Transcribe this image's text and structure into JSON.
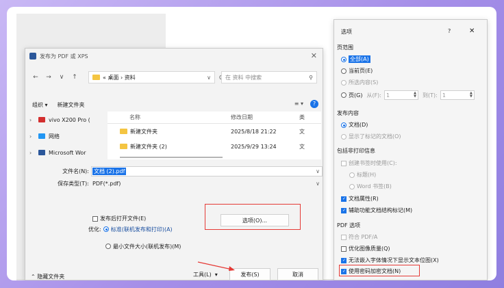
{
  "save_dialog": {
    "title": "发布为 PDF 或 XPS",
    "close": "✕",
    "nav": {
      "back": "←",
      "forward": "→",
      "dropdown": "∨",
      "up": "↑"
    },
    "address": {
      "sep": "«",
      "folder": "桌面",
      "arrow": "›",
      "subfolder": "资料",
      "dropdown": "∨"
    },
    "refresh": "C",
    "search_placeholder": "在 资料 中搜索",
    "search_icon": "⚲",
    "toolbar": {
      "organize": "组织 ▾",
      "new_folder": "新建文件夹",
      "view": "≡ ▾",
      "help": "?"
    },
    "tree": [
      {
        "label": "vivo X200 Pro (",
        "icon_color": "#d32f2f"
      },
      {
        "label": "网络",
        "icon_color": "#2196f3"
      },
      {
        "label": "Microsoft Wor",
        "icon_color": "#2b579a"
      }
    ],
    "columns": {
      "name": "名称",
      "date": "修改日期",
      "type": "类"
    },
    "files": [
      {
        "name": "新建文件夹",
        "date": "2025/8/18 21:22",
        "type": "文"
      },
      {
        "name": "新建文件夹 (2)",
        "date": "2025/9/29 13:24",
        "type": "文"
      }
    ],
    "filename_label": "文件名(N):",
    "filename_value": "文档 (2).pdf",
    "filetype_label": "保存类型(T):",
    "filetype_value": "PDF(*.pdf)",
    "open_after": "发布后打开文件(E)",
    "optimize_label": "优化:",
    "opt_standard": "标准(联机发布和打印)(A)",
    "opt_minimum": "最小文件大小(联机发布)(M)",
    "options_button": "选项(O)...",
    "hide_folders": "隐藏文件夹",
    "tools": "工具(L)",
    "tools_arrow": "▾",
    "publish": "发布(S)",
    "cancel": "取消"
  },
  "options_dialog": {
    "title": "选项",
    "help": "?",
    "close": "✕",
    "page_range_title": "页范围",
    "all": "全部(A)",
    "current_page": "当前页(E)",
    "selection": "所选内容(S)",
    "pages": "页(G)",
    "from_label": "从(F):",
    "from_value": "1",
    "to_label": "到(T):",
    "to_value": "1",
    "publish_what_title": "发布内容",
    "document": "文档(D)",
    "doc_markup": "显示了标记的文档(O)",
    "nonprint_title": "包括非打印信息",
    "bookmarks": "创建书签时使用(C):",
    "headings": "标题(H)",
    "word_bookmarks": "Word 书签(B)",
    "doc_props": "文档属性(R)",
    "accessibility": "辅助功能文档结构标记(M)",
    "pdf_options_title": "PDF 选项",
    "pdfa": "符合 PDF/A",
    "optimize_image": "优化图像质量(Q)",
    "bitmap_text": "无法嵌入字体情况下显示文本位图(X)",
    "encrypt": "使用密码加密文档(N)"
  },
  "colors": {
    "accent": "#1a73e8",
    "highlight": "#e53935",
    "background": "#a58ee8"
  }
}
